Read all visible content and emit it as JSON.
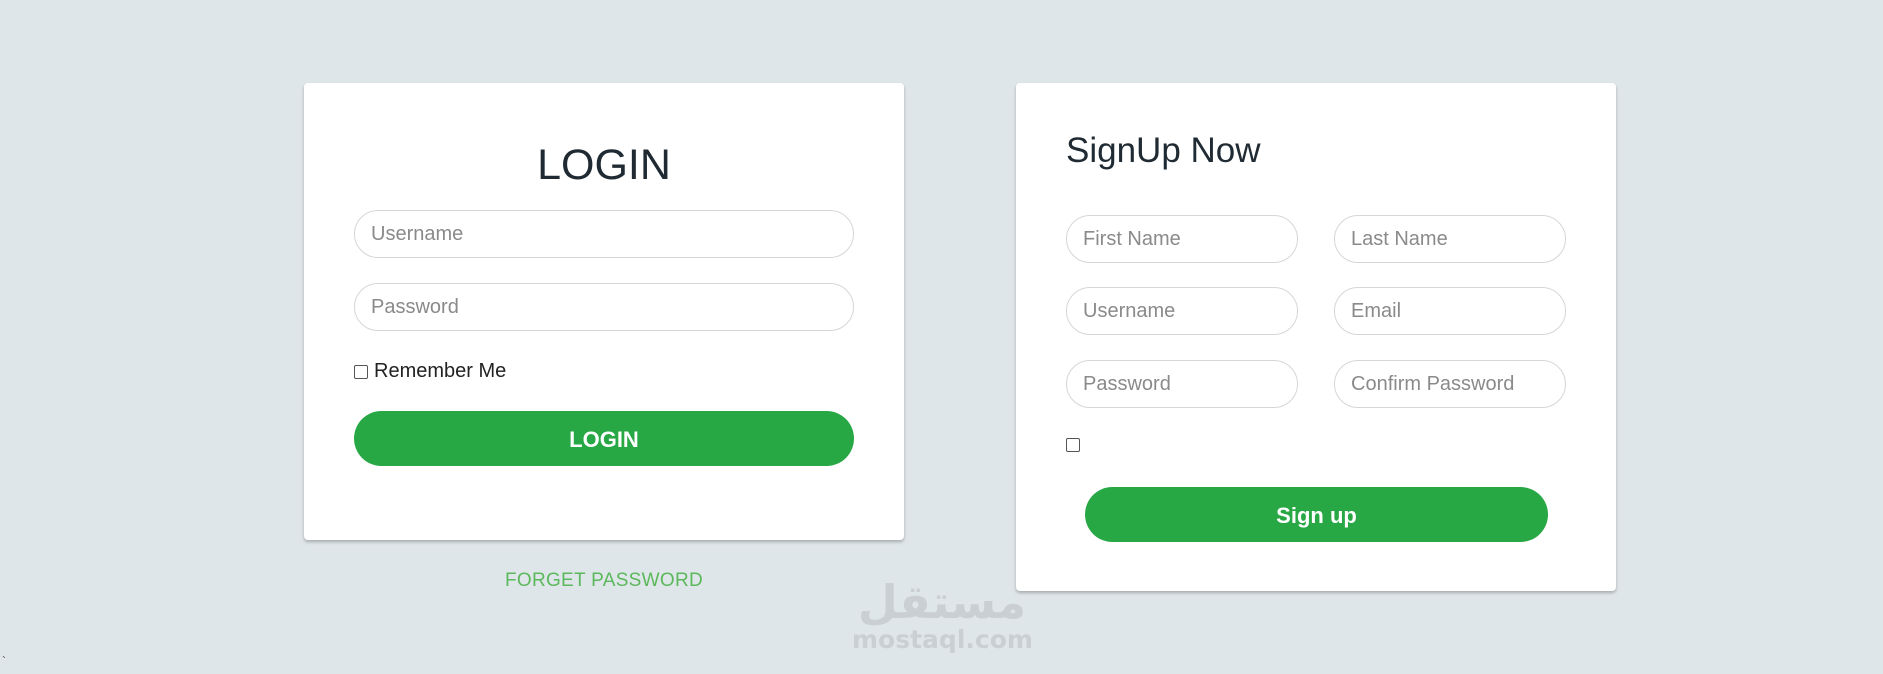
{
  "login": {
    "title": "LOGIN",
    "username_placeholder": "Username",
    "password_placeholder": "Password",
    "remember_label": "Remember Me",
    "button_label": "LOGIN",
    "forget_password_label": "FORGET PASSWORD"
  },
  "signup": {
    "title": "SignUp Now",
    "first_name_placeholder": "First Name",
    "last_name_placeholder": "Last Name",
    "username_placeholder": "Username",
    "email_placeholder": "Email",
    "password_placeholder": "Password",
    "confirm_password_placeholder": "Confirm Password",
    "button_label": "Sign up"
  },
  "watermark": {
    "logo_text": "مستقل",
    "domain": "mostaql.com"
  },
  "stray_char": "`",
  "colors": {
    "background": "#dfe6e9",
    "primary_button": "#28a745",
    "link": "#5cb85c"
  }
}
